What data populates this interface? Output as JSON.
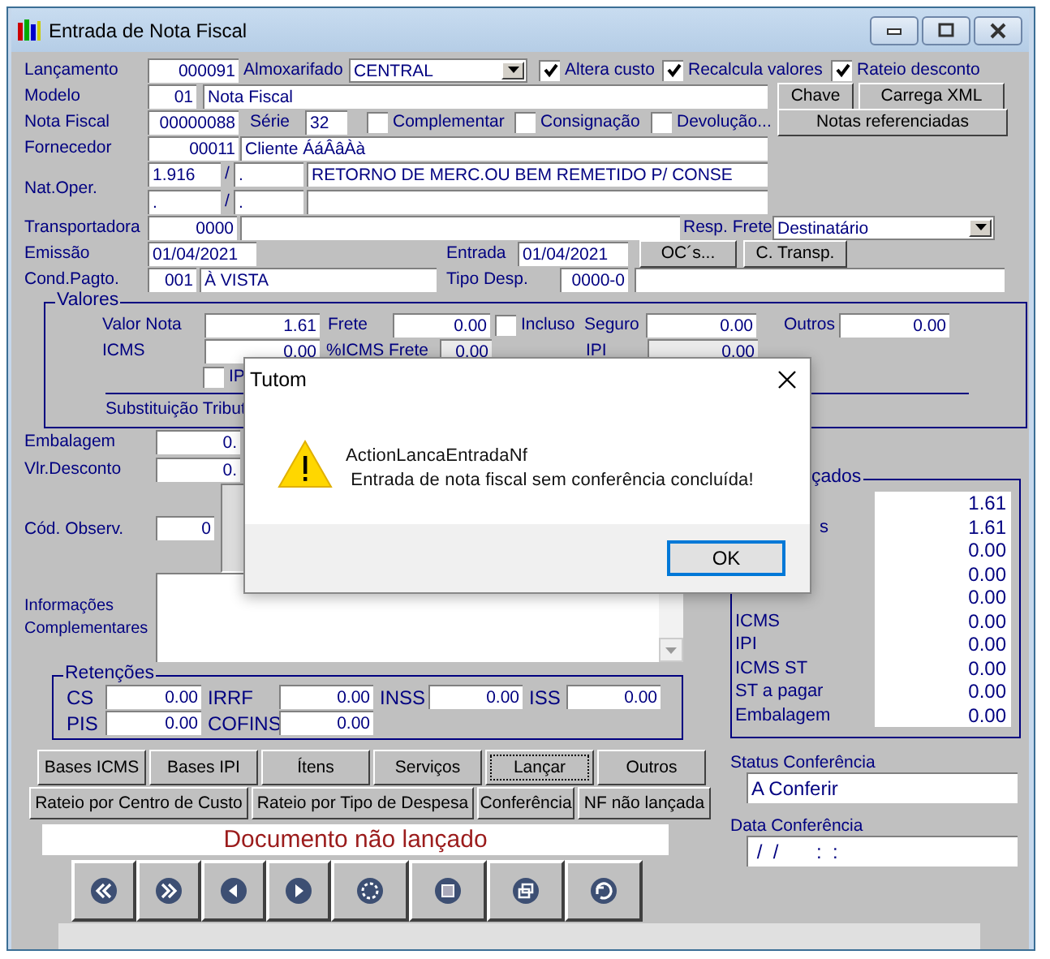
{
  "window": {
    "title": "Entrada de Nota Fiscal"
  },
  "header": {
    "lancamento": {
      "label": "Lançamento",
      "value": "000091"
    },
    "almoxarifado": {
      "label": "Almoxarifado",
      "value": "CENTRAL"
    },
    "options": [
      {
        "label": "Altera custo",
        "checked": true
      },
      {
        "label": "Recalcula valores",
        "checked": true
      },
      {
        "label": "Rateio desconto",
        "checked": true
      }
    ],
    "modelo": {
      "label": "Modelo",
      "code": "01",
      "name": "Nota Fiscal"
    },
    "nota_fiscal": {
      "label": "Nota Fiscal",
      "value": "00000088",
      "serie_label": "Série",
      "serie": "32"
    },
    "types": [
      {
        "label": "Complementar",
        "checked": false
      },
      {
        "label": "Consignação",
        "checked": false
      },
      {
        "label": "Devolução...",
        "checked": false
      }
    ],
    "buttons": [
      "Chave",
      "Carrega XML",
      "Notas referenciadas"
    ],
    "fornecedor": {
      "label": "Fornecedor",
      "code": "00011",
      "name": "Cliente ÁáÂâÀà"
    },
    "nat_oper": {
      "label": "Nat.Oper.",
      "rows": [
        {
          "code": "1.916",
          "separator": "/",
          "sub": ".",
          "description": "RETORNO DE MERC.OU BEM REMETIDO P/ CONSE"
        },
        {
          "code": ".",
          "separator": "/",
          "sub": "."
        }
      ]
    },
    "transportadora": {
      "label": "Transportadora",
      "code": "0000"
    },
    "resp_frete": {
      "label": "Resp. Frete",
      "value": "Destinatário"
    },
    "emissao": {
      "label": "Emissão",
      "value": "01/04/2021"
    },
    "entrada": {
      "label": "Entrada",
      "value": "01/04/2021"
    },
    "entrada_buttons": [
      "OC´s...",
      "C. Transp."
    ],
    "cond_pagto": {
      "label": "Cond.Pagto.",
      "code": "001",
      "name": "À VISTA"
    },
    "tipo_desp": {
      "label": "Tipo Desp.",
      "code": "0000-0"
    }
  },
  "valores": {
    "title": "Valores",
    "valor_nota": {
      "label": "Valor Nota",
      "value": "1.61"
    },
    "frete": {
      "label": "Frete",
      "value": "0.00"
    },
    "incluso": {
      "label": "Incluso",
      "checked": false
    },
    "seguro": {
      "label": "Seguro",
      "value": "0.00"
    },
    "outros": {
      "label": "Outros",
      "value": "0.00"
    },
    "icms": {
      "label": "ICMS",
      "value": "0.00"
    },
    "icms_frete": {
      "label": "%ICMS Frete",
      "value": "0.00"
    },
    "ipi": {
      "label": "IPI",
      "value": "0.00"
    },
    "ipi_check": {
      "label": "IP",
      "checked": false
    },
    "substituicao": "Substituição Tribut"
  },
  "embalagem": {
    "label": "Embalagem",
    "value": "0."
  },
  "desconto": {
    "label": "Vlr.Desconto",
    "value": "0."
  },
  "observacao": {
    "label": "Cód. Observ.",
    "value": "0"
  },
  "informacoes": {
    "label": "Informações Complementares"
  },
  "retencoes": {
    "title": "Retenções",
    "items": [
      {
        "label": "CS",
        "value": "0.00"
      },
      {
        "label": "IRRF",
        "value": "0.00"
      },
      {
        "label": "INSS",
        "value": "0.00"
      },
      {
        "label": "ISS",
        "value": "0.00"
      },
      {
        "label": "PIS",
        "value": "0.00"
      },
      {
        "label": "COFINS",
        "value": "0.00"
      }
    ]
  },
  "totais": {
    "title": "çados",
    "rows": [
      {
        "kind": "hidden",
        "value": "1.61"
      },
      {
        "kind": "clipped",
        "label": "s",
        "value": "1.61"
      },
      {
        "kind": "hidden",
        "value": "0.00"
      },
      {
        "kind": "hidden",
        "value": "0.00"
      },
      {
        "kind": "hidden",
        "value": "0.00"
      },
      {
        "kind": "full",
        "label": "ICMS",
        "value": "0.00"
      },
      {
        "kind": "full",
        "label": "IPI",
        "value": "0.00"
      },
      {
        "kind": "full",
        "label": "ICMS ST",
        "value": "0.00"
      },
      {
        "kind": "full",
        "label": "ST a pagar",
        "value": "0.00"
      },
      {
        "kind": "full",
        "label": "Embalagem",
        "value": "0.00"
      }
    ]
  },
  "actions": [
    {
      "label": "Bases ICMS",
      "focused": false
    },
    {
      "label": "Bases IPI",
      "focused": false
    },
    {
      "label": "Ítens",
      "focused": false
    },
    {
      "label": "Serviços",
      "focused": false
    },
    {
      "label": "Lançar",
      "focused": true
    },
    {
      "label": "Outros",
      "focused": false
    }
  ],
  "actions2": [
    "Rateio por Centro de Custo",
    "Rateio por Tipo de Despesa",
    "Conferência",
    "NF não lançada"
  ],
  "documento_status": "Documento não lançado",
  "status_conferencia": {
    "label": "Status Conferência",
    "value": "A Conferir"
  },
  "data_conferencia": {
    "label": "Data Conferência",
    "value": " /  /       :  :"
  },
  "dialog": {
    "title": "Tutom",
    "lines": [
      "ActionLancaEntradaNf",
      " Entrada de nota fiscal sem conferência concluída!"
    ],
    "button": "OK"
  }
}
